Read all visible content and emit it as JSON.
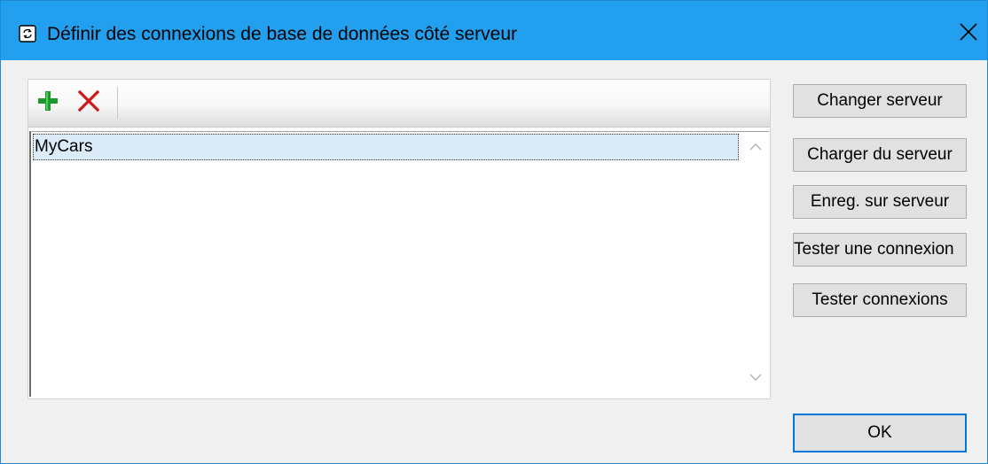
{
  "window": {
    "title": "Définir des connexions de base de données côté serveur",
    "icon": "server-sync-icon",
    "close_icon": "close-icon"
  },
  "toolbar": {
    "add_icon": "plus-icon",
    "delete_icon": "delete-x-icon",
    "add_color": "#1a9a2a",
    "delete_color": "#d01818"
  },
  "connections": {
    "items": [
      {
        "label": "MyCars",
        "selected": true
      }
    ]
  },
  "buttons": {
    "change_server": "Changer serveur",
    "load_from_server": "Charger du serveur",
    "save_to_server": "Enreg. sur serveur",
    "test_connection": "Tester une connexion",
    "test_connections": "Tester connexions",
    "ok": "OK"
  },
  "colors": {
    "titlebar": "#22a0ef",
    "selection": "#dcebfa",
    "default_button_border": "#0078d7"
  }
}
